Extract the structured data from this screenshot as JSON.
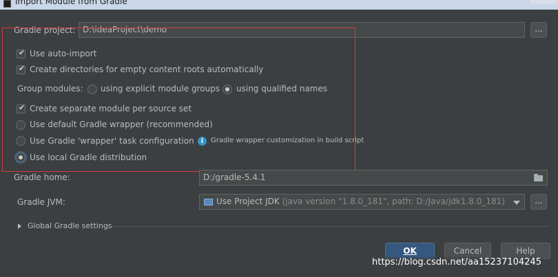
{
  "window": {
    "title": "Import Module from Gradle"
  },
  "gradle_project": {
    "label": "Gradle project:",
    "value": "D:\\ideaProject\\demo",
    "browse_label": "..."
  },
  "options": {
    "auto_import": {
      "label": "Use auto-import",
      "checked": true
    },
    "create_dirs": {
      "label": "Create directories for empty content roots automatically",
      "checked": true
    },
    "group_modules": {
      "label": "Group modules:",
      "explicit": {
        "label": "using explicit module groups",
        "selected": false
      },
      "qualified": {
        "label": "using qualified names",
        "selected": true
      }
    },
    "separate_module": {
      "label": "Create separate module per source set",
      "checked": true
    },
    "default_wrapper": {
      "label": "Use default Gradle wrapper (recommended)",
      "selected": false
    },
    "wrapper_task": {
      "label": "Use Gradle 'wrapper' task configuration",
      "selected": false,
      "info": "Gradle wrapper customization in build script"
    },
    "local_distribution": {
      "label": "Use local Gradle distribution",
      "selected": true
    }
  },
  "gradle_home": {
    "label": "Gradle home:",
    "value": "D:/gradle-5.4.1"
  },
  "gradle_jvm": {
    "label": "Gradle JVM:",
    "value": "Use Project JDK",
    "detail": "(java version \"1.8.0_181\", path: D:/Java/jdk1.8.0_181)",
    "browse_label": "..."
  },
  "global_settings": {
    "label": "Global Gradle settings"
  },
  "buttons": {
    "ok": "OK",
    "cancel": "Cancel",
    "help": "Help"
  },
  "watermark": "https://blog.csdn.net/aa15237104245",
  "colors": {
    "background": "#3c3f41",
    "highlight_border": "#d43b3b",
    "default_button": "#365880",
    "info": "#3592c4"
  }
}
